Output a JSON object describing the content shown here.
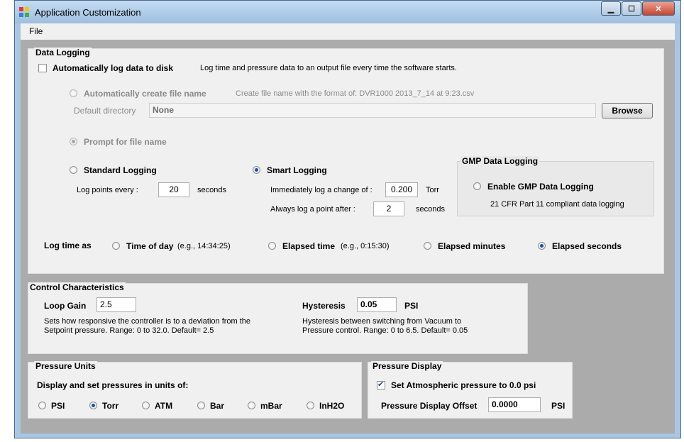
{
  "window": {
    "title": "Application Customization",
    "buttons": {
      "minimize": "▁",
      "maximize": "☐",
      "close": "✕"
    }
  },
  "menu": {
    "file": "File"
  },
  "data_logging": {
    "group_label": "Data Logging",
    "auto_log_label": "Automatically log data to disk",
    "auto_log_checked": false,
    "auto_log_desc": "Log time and pressure data to an output file every time the software starts.",
    "auto_create_label": "Automatically create file name",
    "auto_create_desc": "Create file name with the format of: DVR1000 2013_7_14 at 9:23.csv",
    "default_dir_label": "Default directory",
    "default_dir_value": "None",
    "browse_label": "Browse",
    "prompt_label": "Prompt for file name",
    "standard_label": "Standard Logging",
    "log_points_label": "Log points every :",
    "log_points_value": "20",
    "log_points_unit": "seconds",
    "smart_label": "Smart Logging",
    "imm_log_label": "Immediately log a change of :",
    "imm_log_value": "0.200",
    "imm_log_unit": "Torr",
    "always_log_label": "Always log a point after :",
    "always_log_value": "2",
    "always_log_unit": "seconds",
    "log_time_label": "Log time as",
    "time_of_day_label": "Time of day",
    "time_of_day_example": "(e.g., 14:34:25)",
    "elapsed_time_label": "Elapsed time",
    "elapsed_time_example": "(e.g., 0:15:30)",
    "elapsed_minutes_label": "Elapsed minutes",
    "elapsed_seconds_label": "Elapsed seconds",
    "selected_log_time": "Elapsed seconds"
  },
  "gmp": {
    "group_label": "GMP Data Logging",
    "enable_label": "Enable GMP Data Logging",
    "desc": "21 CFR Part 11 compliant data logging"
  },
  "control": {
    "group_label": "Control Characteristics",
    "loop_gain_label": "Loop Gain",
    "loop_gain_value": "2.5",
    "loop_gain_desc1": "Sets how responsive the controller is to a deviation from the",
    "loop_gain_desc2": "Setpoint pressure.  Range: 0 to 32.0.   Default= 2.5",
    "hysteresis_label": "Hysteresis",
    "hysteresis_value": "0.05",
    "hysteresis_unit": "PSI",
    "hysteresis_desc1": "Hysteresis between switching from Vacuum to",
    "hysteresis_desc2": "Pressure control.  Range: 0 to 6.5.  Default= 0.05"
  },
  "pressure_units": {
    "group_label": "Pressure Units",
    "prompt": "Display and set pressures in units of:",
    "options": [
      "PSI",
      "Torr",
      "ATM",
      "Bar",
      "mBar",
      "InH2O"
    ],
    "selected": "Torr"
  },
  "pressure_display": {
    "group_label": "Pressure Display",
    "atm_label": "Set Atmospheric pressure to 0.0 psi",
    "atm_checked": true,
    "offset_label": "Pressure Display Offset",
    "offset_value": "0.0000",
    "offset_unit": "PSI"
  }
}
